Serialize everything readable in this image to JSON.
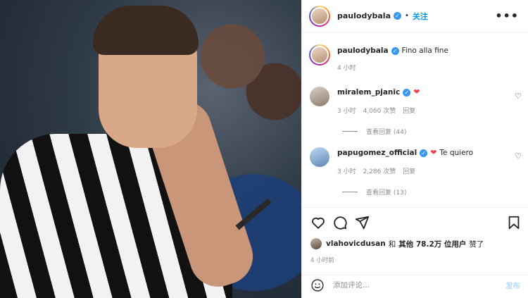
{
  "post": {
    "author": "paulodybala",
    "follow_label": "关注",
    "separator": "•",
    "more_label": "•••",
    "caption": "Fino alla fine",
    "caption_time": "4 小时"
  },
  "comments": [
    {
      "user": "miralem_pjanic",
      "text": "",
      "has_heart": true,
      "time": "3 小时",
      "likes": "4,060 次赞",
      "reply_label": "回复",
      "view_replies": "查看回复 (44)"
    },
    {
      "user": "papugomez_official",
      "text": "Te quiero",
      "has_heart": true,
      "time": "3 小时",
      "likes": "2,286 次赞",
      "reply_label": "回复",
      "view_replies": "查看回复 (13)"
    }
  ],
  "likes": {
    "user": "vlahovicdusan",
    "and": "和",
    "others": "其他 78.2万 位用户",
    "suffix": "赞了"
  },
  "post_time": "4 小时前",
  "add_comment": {
    "placeholder": "添加评论...",
    "post_label": "发布"
  },
  "icons": [
    "heart-icon",
    "comment-icon",
    "share-icon",
    "bookmark-icon",
    "emoji-icon",
    "verified-icon",
    "more-icon"
  ],
  "colors": {
    "accent": "#0095f6",
    "verified": "#3897f0",
    "heart": "#ed4956",
    "muted": "#8e8e8e"
  }
}
